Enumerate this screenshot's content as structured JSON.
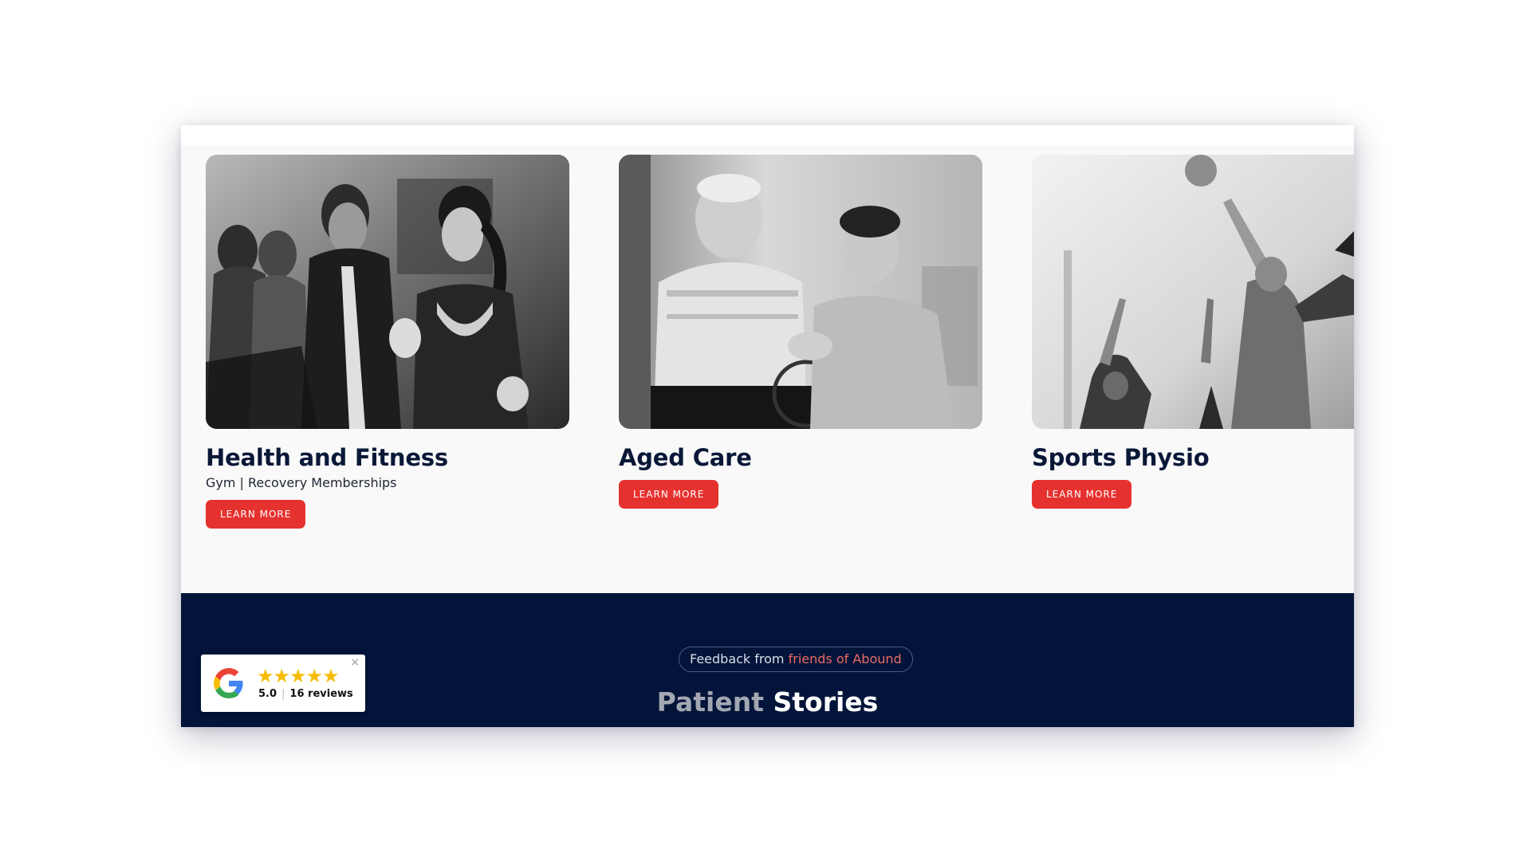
{
  "services": [
    {
      "title": "Health and Fitness",
      "subtitle": "Gym | Recovery Memberships",
      "button": "LEARN MORE"
    },
    {
      "title": "Aged Care",
      "button": "LEARN MORE"
    },
    {
      "title": "Sports Physio",
      "button": "LEARN MORE"
    }
  ],
  "testimonials": {
    "pill_prefix": "Feedback from",
    "pill_accent": "friends of Abound",
    "heading_muted": "Patient",
    "heading_main": "Stories"
  },
  "google_badge": {
    "stars": "★★★★★",
    "rating": "5.0",
    "reviews": "16 reviews",
    "close": "×"
  },
  "colors": {
    "accent": "#e6322f",
    "navy": "#03143a",
    "title": "#0a1838",
    "star": "#f6bb06"
  },
  "icons": [
    "google-logo-icon",
    "star-icon",
    "close-icon"
  ]
}
